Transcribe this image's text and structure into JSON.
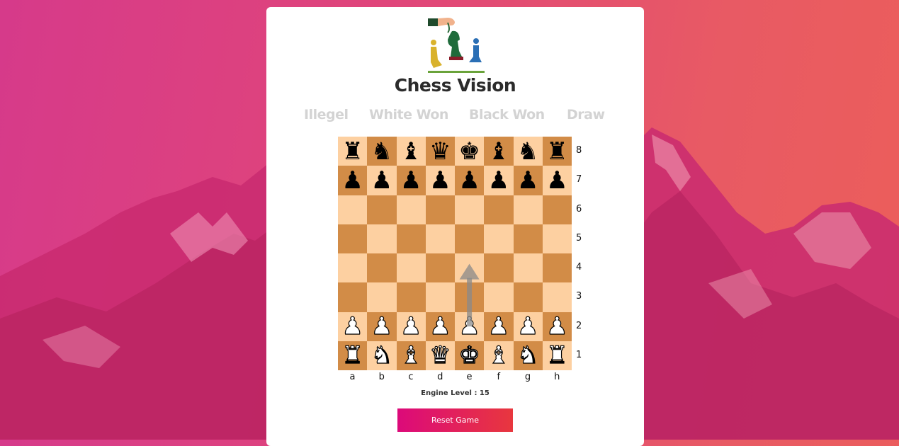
{
  "app": {
    "title": "Chess Vision"
  },
  "status_labels": [
    "Illegel",
    "White Won",
    "Black Won",
    "Draw"
  ],
  "board": {
    "ranks": [
      "8",
      "7",
      "6",
      "5",
      "4",
      "3",
      "2",
      "1"
    ],
    "files": [
      "a",
      "b",
      "c",
      "d",
      "e",
      "f",
      "g",
      "h"
    ],
    "position": [
      [
        "bR",
        "bN",
        "bB",
        "bQ",
        "bK",
        "bB",
        "bN",
        "bR"
      ],
      [
        "bP",
        "bP",
        "bP",
        "bP",
        "bP",
        "bP",
        "bP",
        "bP"
      ],
      [
        "",
        "",
        "",
        "",
        "",
        "",
        "",
        ""
      ],
      [
        "",
        "",
        "",
        "",
        "",
        "",
        "",
        ""
      ],
      [
        "",
        "",
        "",
        "",
        "",
        "",
        "",
        ""
      ],
      [
        "",
        "",
        "",
        "",
        "",
        "",
        "",
        ""
      ],
      [
        "wP",
        "wP",
        "wP",
        "wP",
        "wP",
        "wP",
        "wP",
        "wP"
      ],
      [
        "wR",
        "wN",
        "wB",
        "wQ",
        "wK",
        "wB",
        "wN",
        "wR"
      ]
    ],
    "hint_arrow": {
      "from": "e2",
      "to": "e4",
      "color": "#8a8a8a"
    },
    "colors": {
      "light": "#fdd0a1",
      "dark": "#d28c47"
    }
  },
  "engine": {
    "label": "Engine Level : 15"
  },
  "reset_button": {
    "label": "Reset Game"
  },
  "icons": {
    "logo": "chess-pieces-hand-logo-icon"
  },
  "theme": {
    "accent_start": "#dc0a7a",
    "accent_end": "#e8373e"
  }
}
